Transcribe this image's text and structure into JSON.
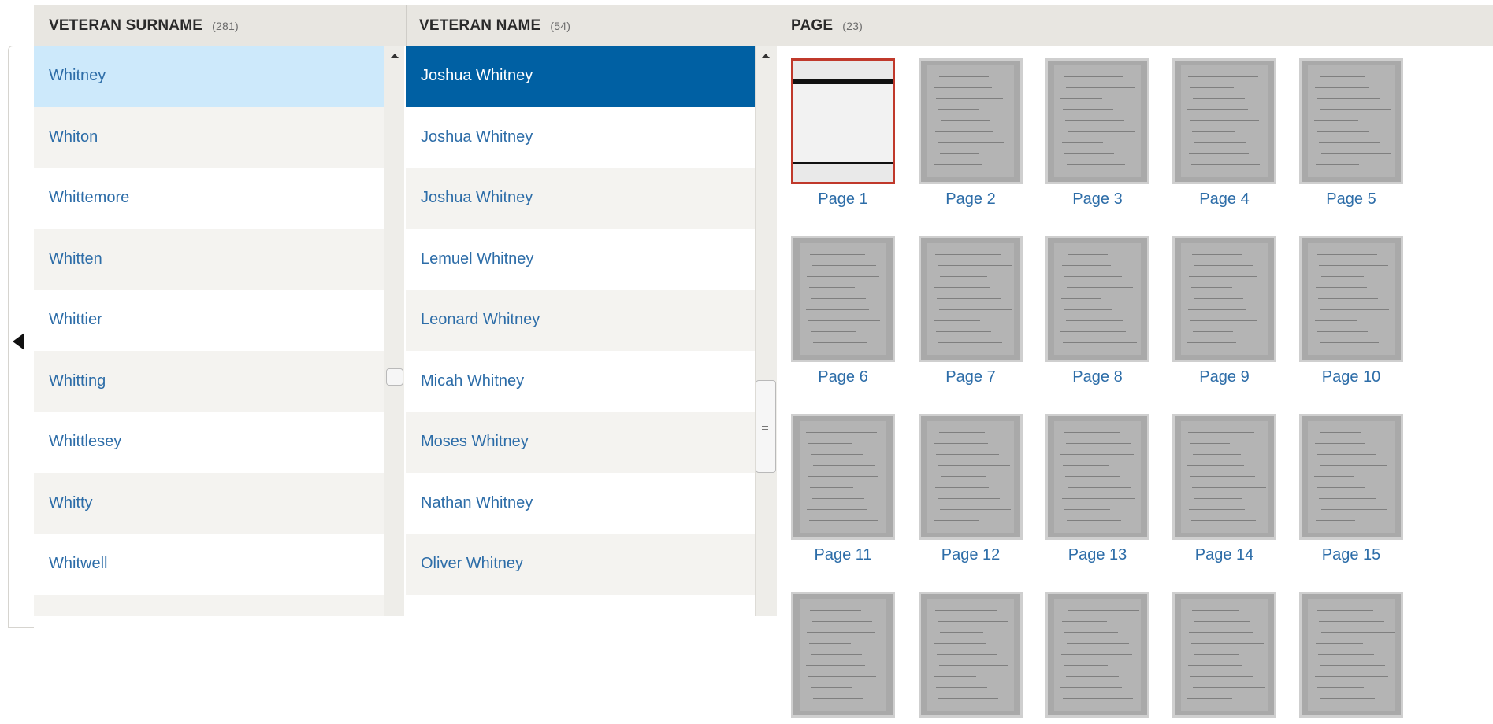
{
  "columns": {
    "surname": {
      "title": "VETERAN SURNAME",
      "count": "(281)"
    },
    "name": {
      "title": "VETERAN NAME",
      "count": "(54)"
    },
    "page": {
      "title": "PAGE",
      "count": "(23)"
    }
  },
  "surnames": [
    "Whitney",
    "Whiton",
    "Whittemore",
    "Whitten",
    "Whittier",
    "Whitting",
    "Whittlesey",
    "Whitty",
    "Whitwell",
    ""
  ],
  "names": [
    "Joshua Whitney",
    "Joshua Whitney",
    "Joshua Whitney",
    "Lemuel Whitney",
    "Leonard Whitney",
    "Micah Whitney",
    "Moses Whitney",
    "Nathan Whitney",
    "Oliver Whitney",
    ""
  ],
  "pages": [
    "Page 1",
    "Page 2",
    "Page 3",
    "Page 4",
    "Page 5",
    "Page 6",
    "Page 7",
    "Page 8",
    "Page 9",
    "Page 10",
    "Page 11",
    "Page 12",
    "Page 13",
    "Page 14",
    "Page 15",
    "",
    "",
    "",
    "",
    ""
  ],
  "colors": {
    "accent": "#0060a3",
    "link": "#2d6da8",
    "selected_light": "#cde9fb",
    "thumb_selected": "#c0392b"
  },
  "icons": {
    "collapse": "triangle-left-icon",
    "scroll_up": "triangle-up-icon"
  }
}
